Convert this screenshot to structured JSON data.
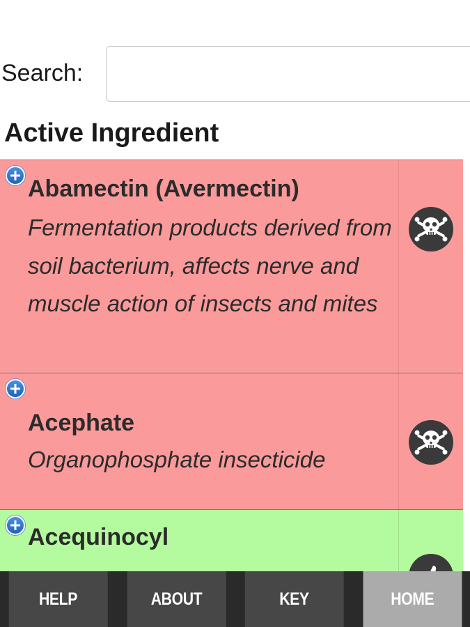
{
  "search": {
    "label": "Search:",
    "value": "",
    "placeholder": ""
  },
  "section": {
    "heading": "Active Ingredient"
  },
  "ingredients": [
    {
      "name": "Abamectin (Avermectin)",
      "description": "Fermentation products derived from soil bacterium, affects nerve and muscle action of insects and mites",
      "status_color": "#fb9a9a",
      "icon": "skull-crossbones-icon"
    },
    {
      "name": "Acephate",
      "description": "Organophosphate insecticide",
      "status_color": "#fb9a9a",
      "icon": "skull-crossbones-icon"
    },
    {
      "name": "Acequinocyl",
      "description": "",
      "status_color": "#b3fb9e",
      "icon": "thumbs-up-icon"
    }
  ],
  "nav": {
    "help": "HELP",
    "about": "ABOUT",
    "key": "KEY",
    "home": "HOME",
    "active": "home"
  }
}
